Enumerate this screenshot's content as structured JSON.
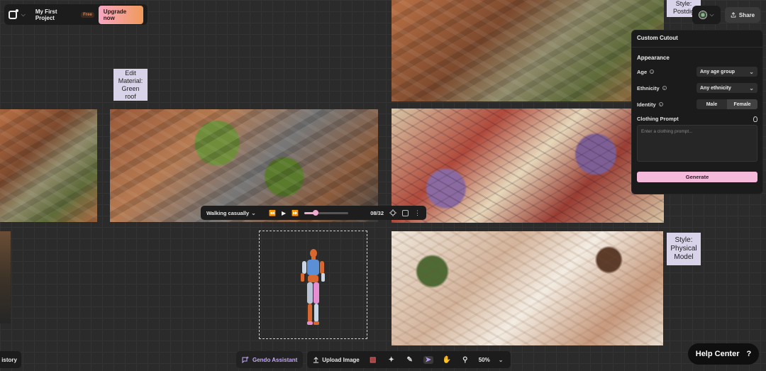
{
  "project": {
    "name": "My First Project",
    "plan_badge": "Free",
    "upgrade_label": "Upgrade now"
  },
  "header": {
    "share_label": "Share"
  },
  "canvas": {
    "notes": [
      {
        "id": "edit-material",
        "text": "Edit Material: Green roof"
      },
      {
        "id": "style-postdigital",
        "text": "Style: Postdig"
      },
      {
        "id": "style-physical",
        "text": "Style: Physical Model"
      }
    ]
  },
  "cutout_panel": {
    "title": "Custom Cutout",
    "appearance_label": "Appearance",
    "age_label": "Age",
    "age_value": "Any age group",
    "ethnicity_label": "Ethnicity",
    "ethnicity_value": "Any ethnicity",
    "identity_label": "Identity",
    "identity_options": [
      "Male",
      "Female"
    ],
    "identity_selected": "Female",
    "clothing_label": "Clothing Prompt",
    "clothing_placeholder": "Enter a clothing prompt...",
    "generate_label": "Generate"
  },
  "playback": {
    "animation": "Walking casually",
    "frames": "08/32",
    "progress": 0.25
  },
  "toolbar": {
    "assistant_label": "Gendo Assistant",
    "upload_label": "Upload Image",
    "zoom": "50%"
  },
  "history_label": "istory",
  "help_label": "Help Center",
  "colors": {
    "accent_pink": "#f5b9dc",
    "accent_purple": "#c5a8f5",
    "note_bg": "#d9d3e9"
  }
}
